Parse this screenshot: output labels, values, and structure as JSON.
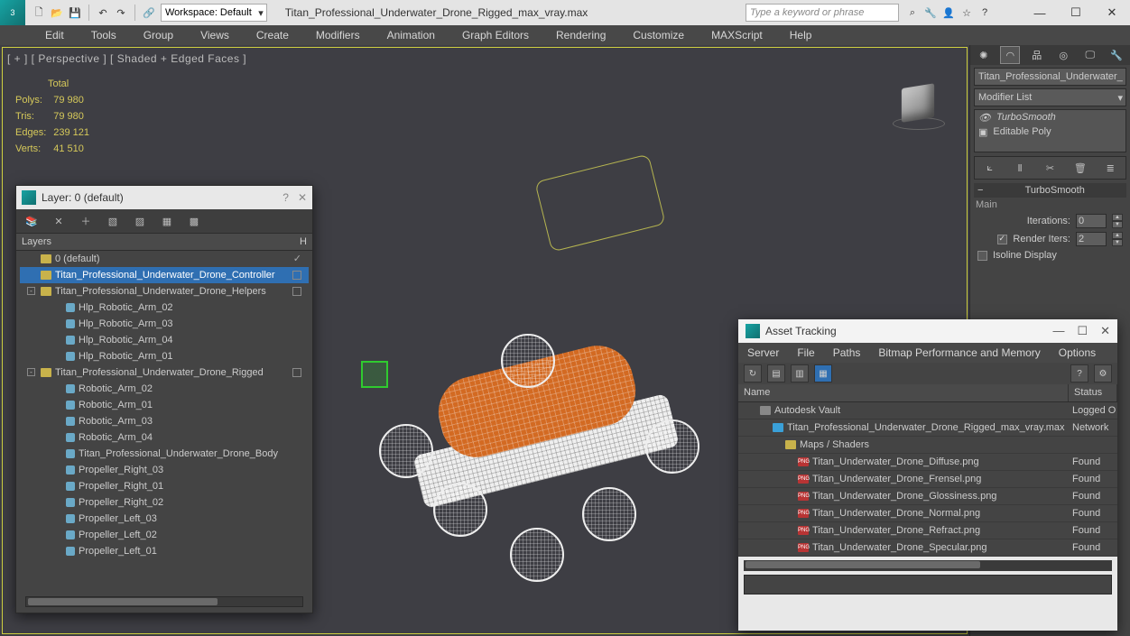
{
  "titlebar": {
    "workspace_label": "Workspace: Default",
    "doc_title": "Titan_Professional_Underwater_Drone_Rigged_max_vray.max",
    "search_placeholder": "Type a keyword or phrase"
  },
  "menu": [
    "Edit",
    "Tools",
    "Group",
    "Views",
    "Create",
    "Modifiers",
    "Animation",
    "Graph Editors",
    "Rendering",
    "Customize",
    "MAXScript",
    "Help"
  ],
  "viewport": {
    "label": "[ + ] [ Perspective ] [ Shaded + Edged Faces ]",
    "stats_header": "Total",
    "stats": [
      {
        "k": "Polys:",
        "v": "79 980"
      },
      {
        "k": "Tris:",
        "v": "79 980"
      },
      {
        "k": "Edges:",
        "v": "239 121"
      },
      {
        "k": "Verts:",
        "v": "41 510"
      }
    ]
  },
  "panel": {
    "obj_name": "Titan_Professional_Underwater_",
    "mod_list_label": "Modifier List",
    "mods": [
      {
        "name": "TurboSmooth",
        "ital": true,
        "eye": true
      },
      {
        "name": "Editable Poly",
        "ital": false,
        "eye": false,
        "box": true
      }
    ],
    "rollout_title": "TurboSmooth",
    "rollout_sub": "Main",
    "iter_label": "Iterations:",
    "iter_val": "0",
    "render_label": "Render Iters:",
    "render_val": "2",
    "isoline_label": "Isoline Display"
  },
  "layer_win": {
    "title": "Layer: 0 (default)",
    "col": "Layers",
    "rows": [
      {
        "d": 0,
        "tw": "",
        "type": "layer",
        "name": "0 (default)",
        "mark": "check"
      },
      {
        "d": 0,
        "tw": "",
        "type": "layer",
        "name": "Titan_Professional_Underwater_Drone_Controller",
        "sel": true,
        "mark": "box"
      },
      {
        "d": 0,
        "tw": "-",
        "type": "layer",
        "name": "Titan_Professional_Underwater_Drone_Helpers",
        "mark": "box"
      },
      {
        "d": 2,
        "tw": " ",
        "type": "obj",
        "name": "Hlp_Robotic_Arm_02"
      },
      {
        "d": 2,
        "tw": " ",
        "type": "obj",
        "name": "Hlp_Robotic_Arm_03"
      },
      {
        "d": 2,
        "tw": " ",
        "type": "obj",
        "name": "Hlp_Robotic_Arm_04"
      },
      {
        "d": 2,
        "tw": " ",
        "type": "obj",
        "name": "Hlp_Robotic_Arm_01"
      },
      {
        "d": 0,
        "tw": "-",
        "type": "layer",
        "name": "Titan_Professional_Underwater_Drone_Rigged",
        "mark": "box"
      },
      {
        "d": 2,
        "tw": " ",
        "type": "obj",
        "name": "Robotic_Arm_02"
      },
      {
        "d": 2,
        "tw": " ",
        "type": "obj",
        "name": "Robotic_Arm_01"
      },
      {
        "d": 2,
        "tw": " ",
        "type": "obj",
        "name": "Robotic_Arm_03"
      },
      {
        "d": 2,
        "tw": " ",
        "type": "obj",
        "name": "Robotic_Arm_04"
      },
      {
        "d": 2,
        "tw": " ",
        "type": "obj",
        "name": "Titan_Professional_Underwater_Drone_Body"
      },
      {
        "d": 2,
        "tw": " ",
        "type": "obj",
        "name": "Propeller_Right_03"
      },
      {
        "d": 2,
        "tw": " ",
        "type": "obj",
        "name": "Propeller_Right_01"
      },
      {
        "d": 2,
        "tw": " ",
        "type": "obj",
        "name": "Propeller_Right_02"
      },
      {
        "d": 2,
        "tw": " ",
        "type": "obj",
        "name": "Propeller_Left_03"
      },
      {
        "d": 2,
        "tw": " ",
        "type": "obj",
        "name": "Propeller_Left_02"
      },
      {
        "d": 2,
        "tw": " ",
        "type": "obj",
        "name": "Propeller_Left_01"
      }
    ]
  },
  "asset_win": {
    "title": "Asset Tracking",
    "menu": [
      "Server",
      "File",
      "Paths",
      "Bitmap Performance and Memory",
      "Options"
    ],
    "col_name": "Name",
    "col_status": "Status",
    "rows": [
      {
        "d": 1,
        "ic": "vault",
        "name": "Autodesk Vault",
        "status": "Logged O"
      },
      {
        "d": 2,
        "ic": "max",
        "name": "Titan_Professional_Underwater_Drone_Rigged_max_vray.max",
        "status": "Network"
      },
      {
        "d": 3,
        "ic": "folder",
        "name": "Maps / Shaders",
        "status": ""
      },
      {
        "d": 4,
        "ic": "png",
        "name": "Titan_Underwater_Drone_Diffuse.png",
        "status": "Found"
      },
      {
        "d": 4,
        "ic": "png",
        "name": "Titan_Underwater_Drone_Frensel.png",
        "status": "Found"
      },
      {
        "d": 4,
        "ic": "png",
        "name": "Titan_Underwater_Drone_Glossiness.png",
        "status": "Found"
      },
      {
        "d": 4,
        "ic": "png",
        "name": "Titan_Underwater_Drone_Normal.png",
        "status": "Found"
      },
      {
        "d": 4,
        "ic": "png",
        "name": "Titan_Underwater_Drone_Refract.png",
        "status": "Found"
      },
      {
        "d": 4,
        "ic": "png",
        "name": "Titan_Underwater_Drone_Specular.png",
        "status": "Found"
      }
    ]
  }
}
